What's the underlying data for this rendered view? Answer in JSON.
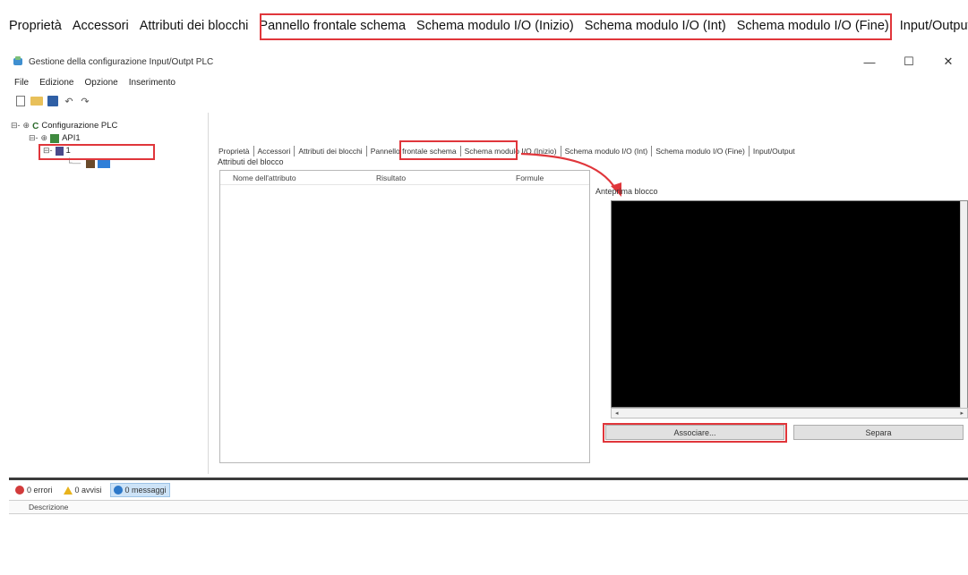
{
  "top_tabs": [
    "Proprietà",
    "Accessori",
    "Attributi dei blocchi",
    "Pannello frontale schema",
    "Schema modulo I/O (Inizio)",
    "Schema modulo I/O (Int)",
    "Schema modulo I/O (Fine)",
    "Input/Output"
  ],
  "window": {
    "title": "Gestione della configurazione Input/Outpt PLC",
    "minimize": "—",
    "maximize": "☐",
    "close": "✕"
  },
  "menu": [
    "File",
    "Edizione",
    "Opzione",
    "Inserimento"
  ],
  "tree": {
    "root": "Configurazione PLC",
    "node1": "API1",
    "node2": "1"
  },
  "inner_tabs": [
    "Proprietà",
    "Accessori",
    "Attributi dei blocchi",
    "Pannello frontale schema",
    "Schema modulo I/O (Inizio)",
    "Schema modulo I/O (Int)",
    "Schema modulo I/O (Fine)",
    "Input/Output"
  ],
  "attributes": {
    "group_label": "Attributi del blocco",
    "columns": [
      "Nome dell'attributo",
      "Risultato",
      "Formule"
    ]
  },
  "preview": {
    "label": "Anteprima blocco"
  },
  "buttons": {
    "associate": "Associare...",
    "separate": "Separa"
  },
  "messages": {
    "errors": "0 errori",
    "warnings": "0 avvisi",
    "infos": "0 messaggi",
    "description_header": "Descrizione"
  },
  "colors": {
    "highlight": "#e0363b",
    "preview_bg": "#000000"
  }
}
